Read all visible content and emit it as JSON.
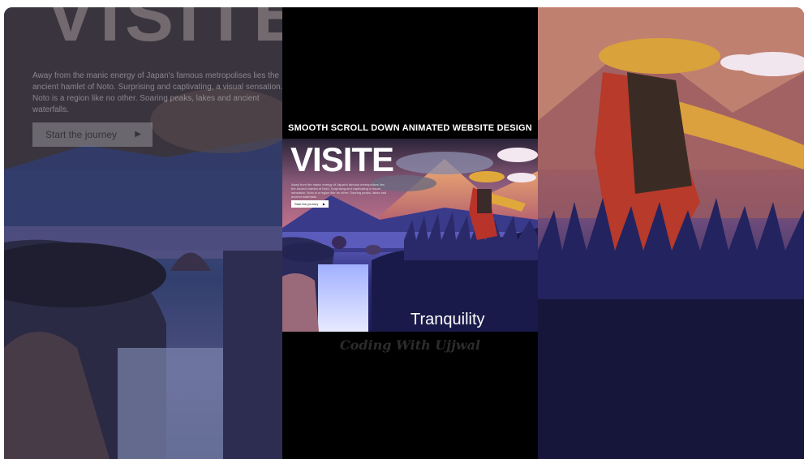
{
  "left_preview": {
    "big_title": "VISITE",
    "paragraph": "Away from the manic energy of Japan's famous metropolises lies the ancient hamlet of Noto. Surprising and captivating, a visual sensation. Noto is a region like no other. Soaring peaks, lakes and ancient waterfalls.",
    "button_label": "Start the journey",
    "button_arrow": "▶"
  },
  "center": {
    "heading": "SMOOTH SCROLL DOWN ANIMATED WEBSITE DESIGN",
    "preview": {
      "title": "VISITE",
      "small_text": "Away from the manic energy of Japan's famous metropolises lies the ancient hamlet of Noto. Surprising and captivating a visual sensation. Noto is a region like no other. Soaring peaks, lakes and ancient waterfalls.",
      "button_label": "Start the journey",
      "button_arrow": "▶",
      "tranquility": "Tranquility"
    },
    "caption": "Coding With Ujjwal"
  },
  "colors": {
    "frame_bg": "#0b0b12",
    "center_bg": "#000000",
    "caption": "#2c2c2c",
    "accent_red": "#b8332a",
    "hat_yellow": "#e0a83a"
  }
}
